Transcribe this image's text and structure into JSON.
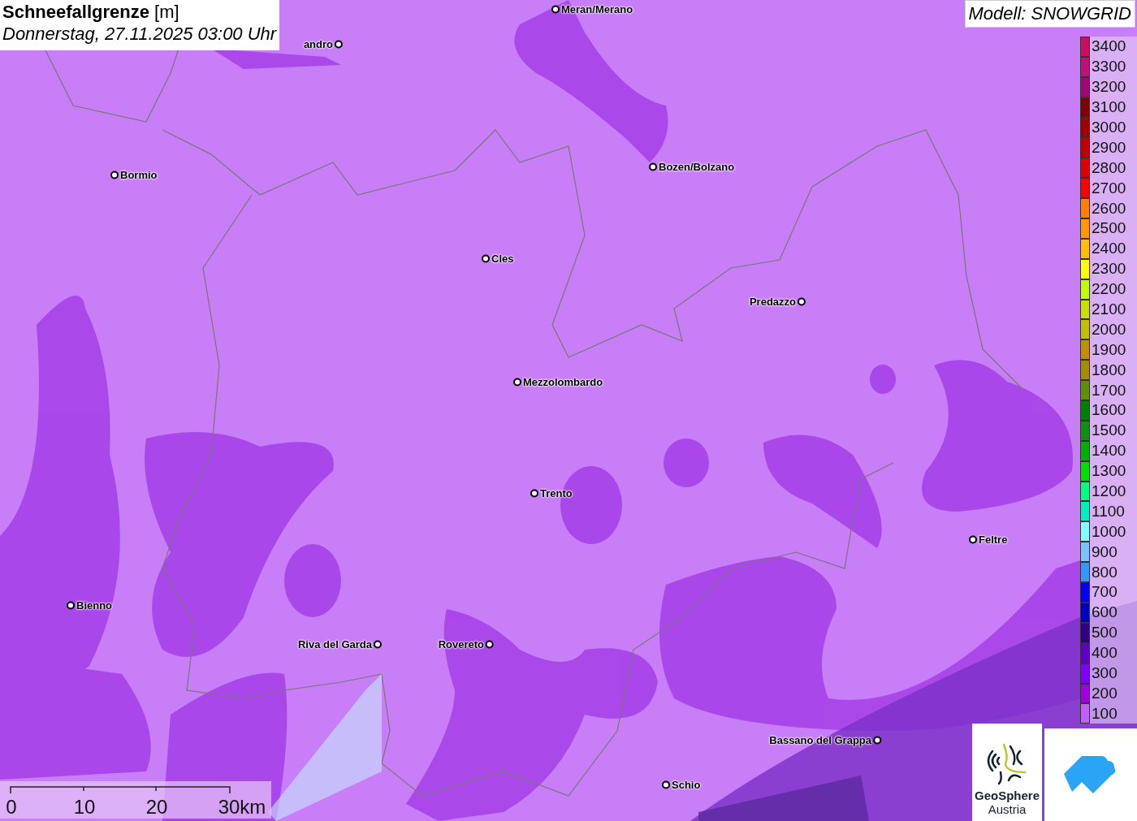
{
  "title": {
    "variable": "Schneefallgrenze",
    "unit": "[m]",
    "date": "Donnerstag, 27.11.2025 03:00 Uhr"
  },
  "model": "Modell: SNOWGRID",
  "cities": [
    {
      "name": "Meran/Merano"
    },
    {
      "name": "andro"
    },
    {
      "name": "Bormio"
    },
    {
      "name": "Bozen/Bolzano"
    },
    {
      "name": "Cles"
    },
    {
      "name": "Predazzo"
    },
    {
      "name": "Mezzolombardo"
    },
    {
      "name": "Trento"
    },
    {
      "name": "Feltre"
    },
    {
      "name": "Bienno"
    },
    {
      "name": "Riva del Garda"
    },
    {
      "name": "Rovereto"
    },
    {
      "name": "Bassano del Grappa"
    },
    {
      "name": "Schio"
    }
  ],
  "legend": [
    {
      "label": "3400",
      "color": "#c8105e"
    },
    {
      "label": "3300",
      "color": "#c01078"
    },
    {
      "label": "3200",
      "color": "#9c0a70"
    },
    {
      "label": "3100",
      "color": "#800000"
    },
    {
      "label": "3000",
      "color": "#a00000"
    },
    {
      "label": "2900",
      "color": "#c00000"
    },
    {
      "label": "2800",
      "color": "#e00000"
    },
    {
      "label": "2700",
      "color": "#ff0000"
    },
    {
      "label": "2600",
      "color": "#ff8000"
    },
    {
      "label": "2500",
      "color": "#ff9900"
    },
    {
      "label": "2400",
      "color": "#ffbf00"
    },
    {
      "label": "2300",
      "color": "#ffff00"
    },
    {
      "label": "2200",
      "color": "#bfff00"
    },
    {
      "label": "2100",
      "color": "#c8e000"
    },
    {
      "label": "2000",
      "color": "#c0c000"
    },
    {
      "label": "1900",
      "color": "#c09000"
    },
    {
      "label": "1800",
      "color": "#a09000"
    },
    {
      "label": "1700",
      "color": "#609000"
    },
    {
      "label": "1600",
      "color": "#008000"
    },
    {
      "label": "1500",
      "color": "#109010"
    },
    {
      "label": "1400",
      "color": "#00b000"
    },
    {
      "label": "1300",
      "color": "#00e000"
    },
    {
      "label": "1200",
      "color": "#00ff80"
    },
    {
      "label": "1100",
      "color": "#00f0c0"
    },
    {
      "label": "1000",
      "color": "#80ffff"
    },
    {
      "label": "900",
      "color": "#80c0ff"
    },
    {
      "label": "800",
      "color": "#3399ff"
    },
    {
      "label": "700",
      "color": "#0000ff"
    },
    {
      "label": "600",
      "color": "#0000c0"
    },
    {
      "label": "500",
      "color": "#300080"
    },
    {
      "label": "400",
      "color": "#6000c0"
    },
    {
      "label": "300",
      "color": "#8000ff"
    },
    {
      "label": "200",
      "color": "#a000e0"
    },
    {
      "label": "100",
      "color": "#c060ff"
    }
  ],
  "scale": [
    "0",
    "10",
    "20",
    "30km"
  ],
  "logos": {
    "name": "GeoSphere",
    "subtitle": "Austria"
  }
}
